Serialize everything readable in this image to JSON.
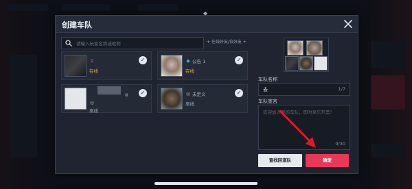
{
  "modal": {
    "title": "创建车队",
    "close_icon": "close-icon",
    "top_marker": "◆"
  },
  "search": {
    "placeholder": "请输入玩家名称或昵称",
    "icon": "search-icon"
  },
  "filter": {
    "label": "+ 在线好友/位好友 +"
  },
  "friends": [
    {
      "name": "",
      "status": "在线",
      "status_icon": "♀",
      "avatar": "dark",
      "checked": true
    },
    {
      "name": "公告 1",
      "status": "在线",
      "status_icon": "◆",
      "avatar": "cat",
      "checked": true
    },
    {
      "name": "g",
      "status": "离线",
      "status_icon": "◎",
      "avatar": "white",
      "checked": true
    },
    {
      "name": "未定义",
      "status": "离线",
      "status_icon": "◎",
      "avatar": "kitten",
      "checked": true
    }
  ],
  "team_name": {
    "label": "车队名称",
    "value": "去",
    "count": "1/7"
  },
  "declaration": {
    "label": "车队宣言",
    "placeholder": "欢迎加入我的车队，即时享乐开黑！",
    "count": "0/30"
  },
  "buttons": {
    "search_team": "查找回道队",
    "confirm": "确定"
  },
  "colors": {
    "accent": "#e8395a",
    "annotation_arrow": "#e2182a",
    "online": "#d8a64a"
  }
}
